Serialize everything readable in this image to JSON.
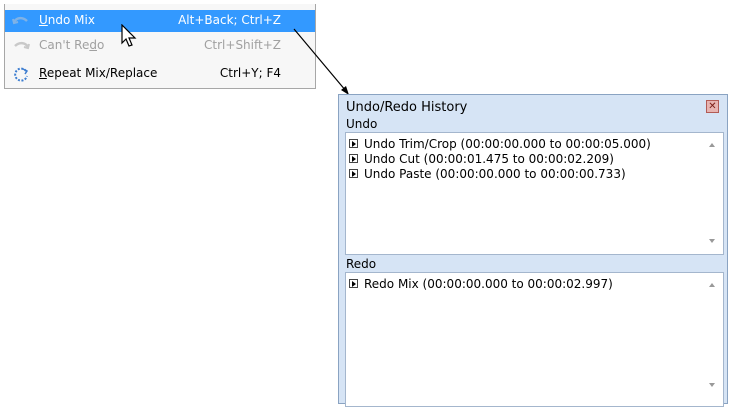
{
  "menu": {
    "items": [
      {
        "label_pre": "",
        "label_ul": "U",
        "label_post": "ndo Mix",
        "shortcut": "Alt+Back; Ctrl+Z"
      },
      {
        "label_pre": "Can't Re",
        "label_ul": "d",
        "label_post": "o",
        "shortcut": "Ctrl+Shift+Z"
      },
      {
        "label_pre": "",
        "label_ul": "R",
        "label_post": "epeat Mix/Replace",
        "shortcut": "Ctrl+Y; F4"
      }
    ]
  },
  "history": {
    "title": "Undo/Redo History",
    "undo_label": "Undo",
    "redo_label": "Redo",
    "undo_items": [
      "Undo Trim/Crop (00:00:00.000 to 00:00:05.000)",
      "Undo Cut (00:00:01.475 to 00:00:02.209)",
      "Undo Paste (00:00:00.000 to 00:00:00.733)"
    ],
    "redo_items": [
      "Redo Mix (00:00:00.000 to 00:00:02.997)"
    ]
  },
  "colors": {
    "menu_highlight": "#3399ff",
    "window_frame": "#d6e4f5",
    "close_button": "#e7b4b1"
  }
}
